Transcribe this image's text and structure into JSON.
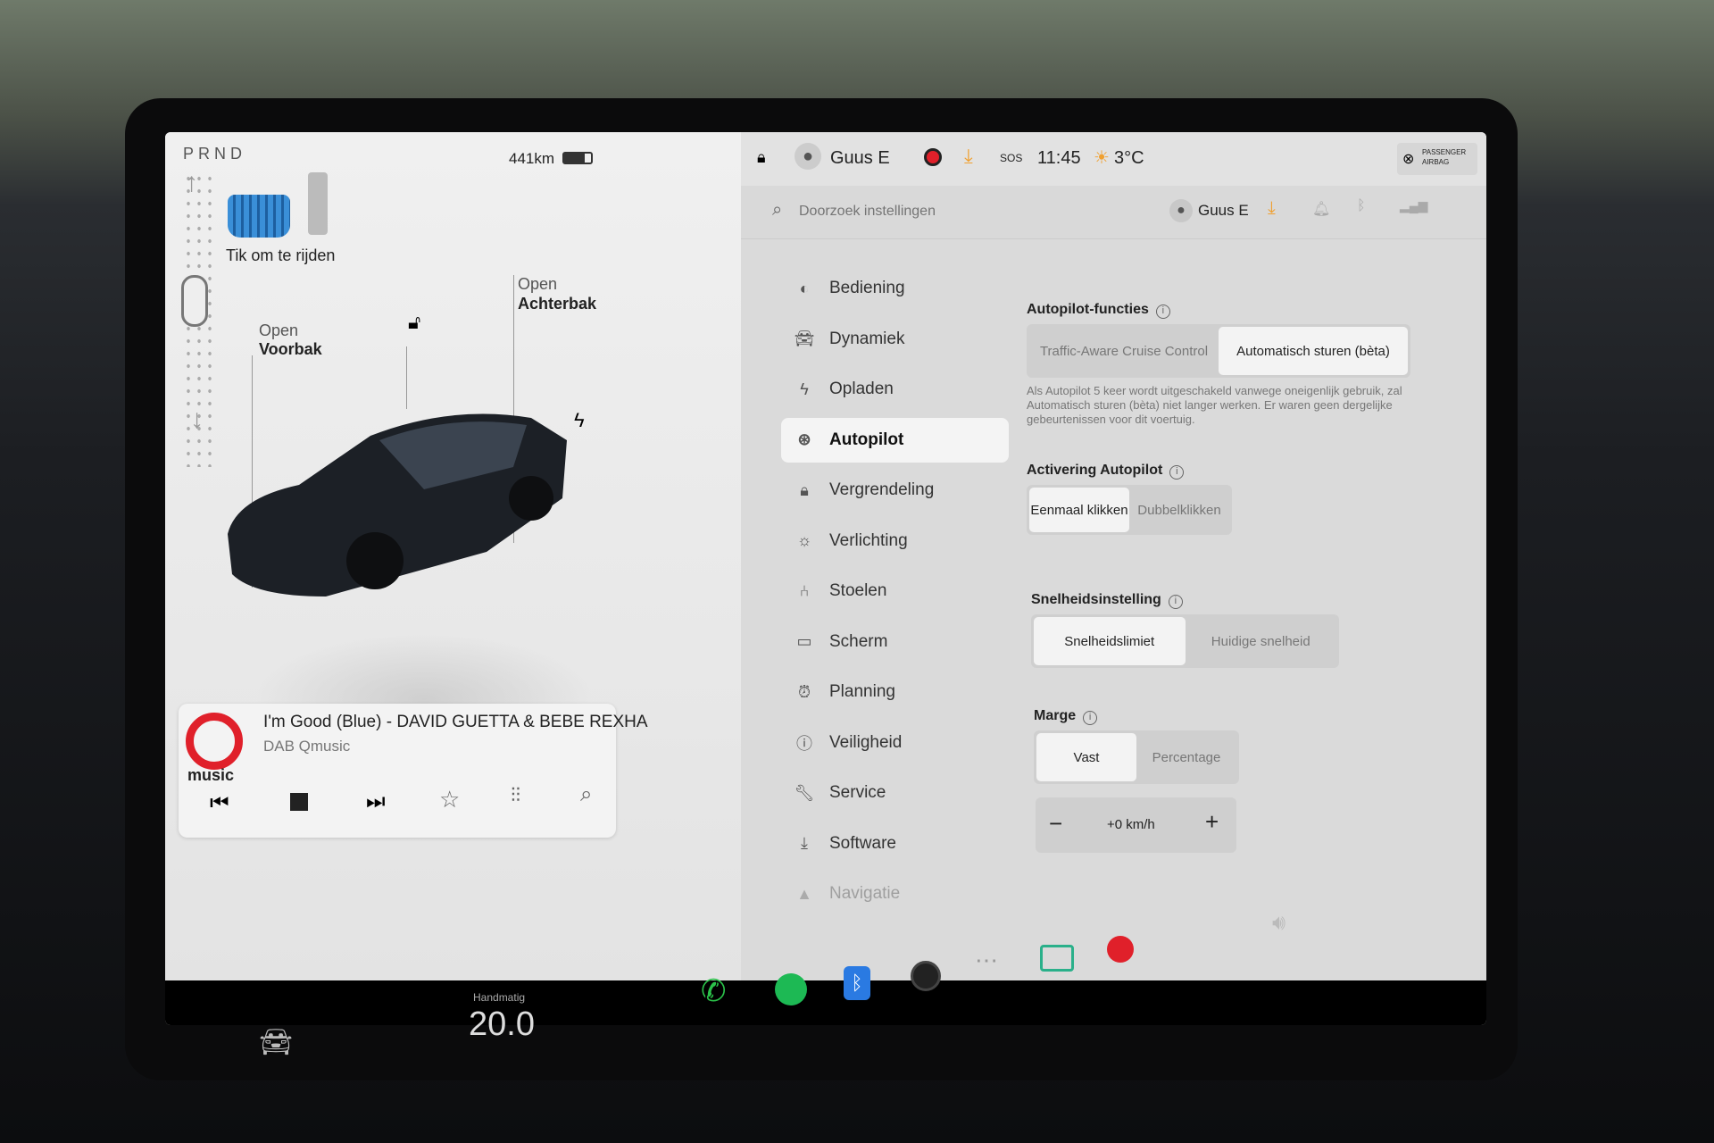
{
  "drive": {
    "gears": "PRND",
    "range": "441km",
    "tap_to_drive": "Tik om te rijden",
    "battery_level": 0.75
  },
  "car": {
    "frunk_open": "Open",
    "frunk_label": "Voorbak",
    "trunk_open": "Open",
    "trunk_label": "Achterbak"
  },
  "status": {
    "user": "Guus E",
    "sos": "SOS",
    "time": "11:45",
    "temperature": "3°C",
    "airbag_line1": "PASSENGER",
    "airbag_line2": "AIRBAG"
  },
  "search": {
    "placeholder": "Doorzoek instellingen",
    "user": "Guus E"
  },
  "menu": [
    {
      "label": "Bediening",
      "icon": "toggle-icon"
    },
    {
      "label": "Dynamiek",
      "icon": "car-icon"
    },
    {
      "label": "Opladen",
      "icon": "bolt-icon"
    },
    {
      "label": "Autopilot",
      "icon": "steering-wheel-icon"
    },
    {
      "label": "Vergrendeling",
      "icon": "lock-icon"
    },
    {
      "label": "Verlichting",
      "icon": "light-icon"
    },
    {
      "label": "Stoelen",
      "icon": "seat-icon"
    },
    {
      "label": "Scherm",
      "icon": "display-icon"
    },
    {
      "label": "Planning",
      "icon": "alarm-icon"
    },
    {
      "label": "Veiligheid",
      "icon": "safety-icon"
    },
    {
      "label": "Service",
      "icon": "wrench-icon"
    },
    {
      "label": "Software",
      "icon": "download-icon"
    },
    {
      "label": "Navigatie",
      "icon": "navigation-icon"
    }
  ],
  "autopilot": {
    "functions_title": "Autopilot-functies",
    "functions_options": [
      "Traffic-Aware Cruise Control",
      "Automatisch sturen (bèta)"
    ],
    "functions_selected": 1,
    "note": "Als Autopilot 5 keer wordt uitgeschakeld vanwege oneigenlijk gebruik, zal Automatisch sturen (bèta) niet langer werken. Er waren geen dergelijke gebeurtenissen voor dit voertuig.",
    "activation_title": "Activering Autopilot",
    "activation_options": [
      "Eenmaal klikken",
      "Dubbelklikken"
    ],
    "speed_title": "Snelheidsinstelling",
    "speed_options": [
      "Snelheidslimiet",
      "Huidige snelheid"
    ],
    "margin_title": "Marge",
    "margin_options": [
      "Vast",
      "Percentage"
    ],
    "margin_value": "+0 km/h",
    "minus": "−",
    "plus": "+"
  },
  "media": {
    "logo": "music",
    "title": "I'm Good (Blue) - DAVID GUETTA & BEBE REXHA",
    "source": "DAB Qmusic"
  },
  "climate": {
    "mode": "Handmatig",
    "temp": "20.0"
  },
  "colors": {
    "accent_red": "#e0202a",
    "download_orange": "#f0a030",
    "spotify": "#1db954",
    "phone": "#2bc24a",
    "bluetooth": "#2a7ae2"
  }
}
